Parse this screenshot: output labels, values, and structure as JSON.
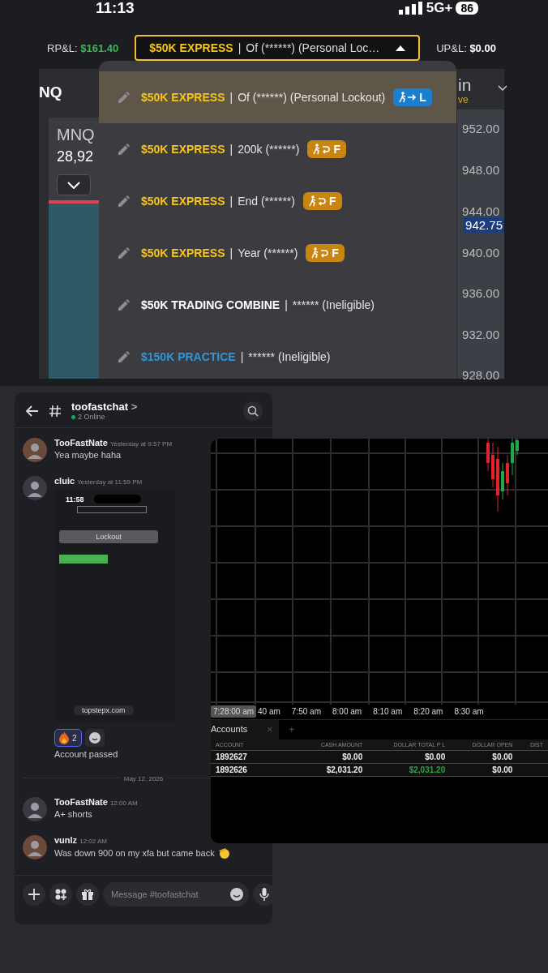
{
  "status_bar": {
    "time": "11:13",
    "network": "5G+",
    "battery": "86"
  },
  "header": {
    "rpl_label": "RP&L:",
    "rpl_value": "$161.40",
    "account_select": {
      "plan": "$50K EXPRESS",
      "separator": "|",
      "detail": "Of (******) (Personal Loc…"
    },
    "upl_label": "UP&L:",
    "upl_value": "$0.00"
  },
  "trading_panel": {
    "symbol_tab": "NQ",
    "column_3": "in",
    "column_3_sub": "ve",
    "contract": "MNQ",
    "contract_price": "28,92",
    "price_axis": [
      {
        "label": "952.00",
        "selected": false
      },
      {
        "label": "948.00",
        "selected": false
      },
      {
        "label": "944.00",
        "selected": false
      },
      {
        "label": "942.75",
        "selected": true
      },
      {
        "label": "940.00",
        "selected": false
      },
      {
        "label": "936.00",
        "selected": false
      },
      {
        "label": "932.00",
        "selected": false
      },
      {
        "label": "928.00",
        "selected": false
      }
    ]
  },
  "account_menu": {
    "items": [
      {
        "plan": {
          "text": "$50K EXPRESS",
          "color": "#f5c518"
        },
        "separator": "|",
        "detail": "Of (******) (Personal Lockout)",
        "badge": {
          "text": "L",
          "kind": "lockout"
        },
        "selected": true
      },
      {
        "plan": {
          "text": "$50K EXPRESS",
          "color": "#f5c518"
        },
        "separator": "|",
        "detail": "200k (******)",
        "badge": {
          "text": "F",
          "kind": "funded"
        },
        "selected": false
      },
      {
        "plan": {
          "text": "$50K EXPRESS",
          "color": "#f5c518"
        },
        "separator": "|",
        "detail": "End (******)",
        "badge": {
          "text": "F",
          "kind": "funded"
        },
        "selected": false
      },
      {
        "plan": {
          "text": "$50K EXPRESS",
          "color": "#f5c518"
        },
        "separator": "|",
        "detail": "Year (******)",
        "badge": {
          "text": "F",
          "kind": "funded"
        },
        "selected": false
      },
      {
        "plan": {
          "text": "$50K TRADING COMBINE",
          "color": "#ffffff"
        },
        "separator": "|",
        "detail": "****** (Ineligible)",
        "selected": false
      },
      {
        "plan": {
          "text": "$150K PRACTICE",
          "color": "#2f95dc"
        },
        "separator": "|",
        "detail": "****** (Ineligible)",
        "selected": false
      }
    ]
  },
  "chat": {
    "channel": "toofastchat",
    "chevron": ">",
    "online": "2 Online",
    "messages": [
      {
        "kind": "message",
        "author": "TooFastNate",
        "time": "Yesterday at 9:57 PM",
        "text": "Yea maybe haha"
      },
      {
        "kind": "attachment",
        "author": "cluic",
        "time": "Yesterday at 11:59 PM",
        "attachment": {
          "time": "11:58",
          "button": "Lockout",
          "url": "topstepx.com"
        },
        "reaction_count": "2",
        "text": "Account passed"
      },
      {
        "kind": "divider",
        "text": "May 12, 2026"
      },
      {
        "kind": "message",
        "author": "TooFastNate",
        "time": "12:00 AM",
        "text": "A+ shorts"
      },
      {
        "kind": "message",
        "author": "vunlz",
        "time": "12:02 AM",
        "text": "Was down 900 on my xfa but came back",
        "emoji": true
      }
    ],
    "composer": {
      "placeholder": "Message #toofastchat"
    }
  },
  "chart_window": {
    "time_axis": [
      {
        "label": "7:28:00 am",
        "selected": true
      },
      {
        "label": "40 am",
        "selected": false
      },
      {
        "label": "7:50 am",
        "selected": false
      },
      {
        "label": "8:00 am",
        "selected": false
      },
      {
        "label": "8:10 am",
        "selected": false
      },
      {
        "label": "8:20 am",
        "selected": false
      },
      {
        "label": "8:30 am",
        "selected": false
      }
    ],
    "panel_tab": "Accounts",
    "close": "×",
    "add": "+",
    "table": {
      "columns": [
        "ACCOUNT",
        "CASH AMOUNT",
        "DOLLAR TOTAL P L",
        "DOLLAR OPEN",
        "DIST"
      ],
      "rows": [
        {
          "cells": [
            "1892627",
            "$0.00",
            "$0.00",
            "$0.00"
          ],
          "positive": false
        },
        {
          "cells": [
            "1892626",
            "$2,031.20",
            "$2,031.20",
            "$0.00"
          ],
          "positive": true
        }
      ]
    }
  }
}
